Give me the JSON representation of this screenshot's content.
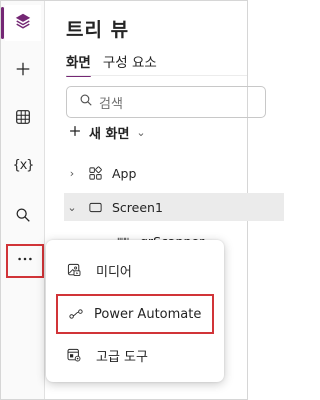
{
  "rail": {
    "items": [
      {
        "name": "tree-view",
        "icon": "layers-icon"
      },
      {
        "name": "insert",
        "icon": "plus-icon"
      },
      {
        "name": "data",
        "icon": "table-icon"
      },
      {
        "name": "variables",
        "icon": "variables-icon",
        "glyph": "{x}"
      },
      {
        "name": "search",
        "icon": "search-icon"
      },
      {
        "name": "more",
        "icon": "ellipsis-icon"
      }
    ]
  },
  "panel": {
    "title": "트리 뷰",
    "tabs": [
      {
        "label": "화면",
        "active": true
      },
      {
        "label": "구성 요소",
        "active": false
      }
    ],
    "search": {
      "placeholder": "검색"
    },
    "new_screen": {
      "label": "새 화면"
    },
    "tree": [
      {
        "label": "App",
        "expander": "›",
        "icon": "app-icon"
      },
      {
        "label": "Screen1",
        "expander": "⌄",
        "icon": "screen-icon"
      },
      {
        "label": "qrScanner",
        "icon": "barcode-icon"
      }
    ]
  },
  "menu": {
    "items": [
      {
        "label": "미디어",
        "icon": "media-icon"
      },
      {
        "label": "Power Automate",
        "icon": "power-automate-icon"
      },
      {
        "label": "고급 도구",
        "icon": "advanced-tools-icon"
      }
    ]
  },
  "colors": {
    "accent": "#742774",
    "highlight": "#d13438"
  }
}
